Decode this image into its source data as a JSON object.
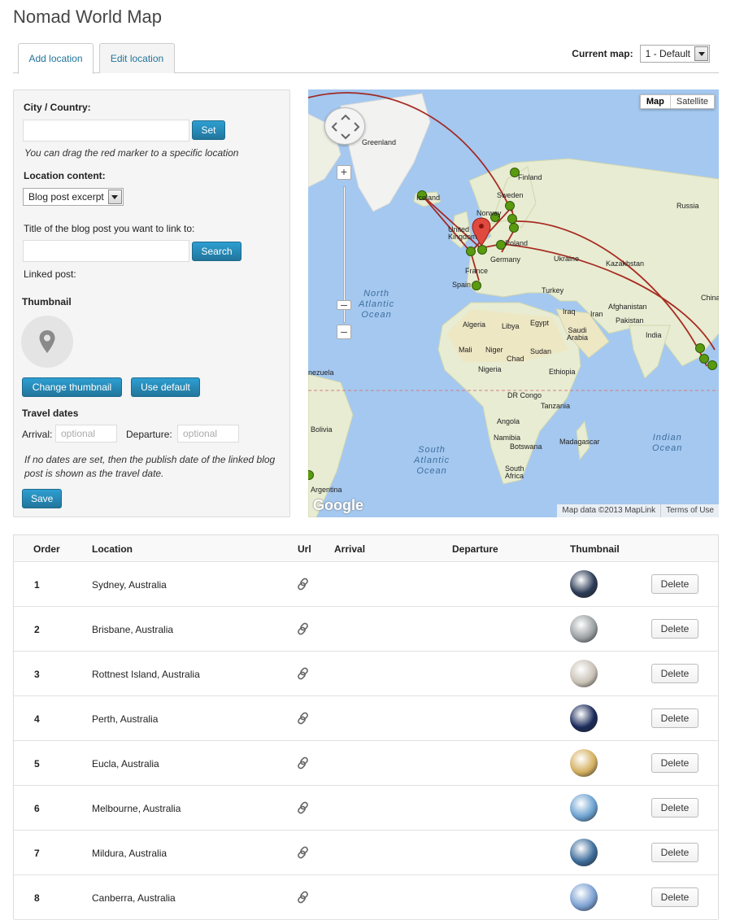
{
  "page": {
    "title": "Nomad World Map"
  },
  "tabs": [
    {
      "label": "Add location",
      "active": true
    },
    {
      "label": "Edit location",
      "active": false
    }
  ],
  "current_map": {
    "label": "Current map:",
    "selected": "1 - Default"
  },
  "form": {
    "city_label": "City / Country:",
    "city_value": "",
    "set_button": "Set",
    "drag_hint": "You can drag the red marker to a specific location",
    "content_label": "Location content:",
    "content_selected": "Blog post excerpt",
    "blog_title_label": "Title of the blog post you want to link to:",
    "blog_title_value": "",
    "search_button": "Search",
    "linked_post_label": "Linked post:",
    "thumbnail_heading": "Thumbnail",
    "change_thumbnail_button": "Change thumbnail",
    "use_default_button": "Use default",
    "travel_dates_heading": "Travel dates",
    "arrival_label": "Arrival:",
    "arrival_placeholder": "optional",
    "departure_label": "Departure:",
    "departure_placeholder": "optional",
    "dates_hint": "If no dates are set, then the publish date of the linked blog post is shown as the travel date.",
    "save_button": "Save"
  },
  "map": {
    "type_buttons": [
      "Map",
      "Satellite"
    ],
    "active_type": "Map",
    "attribution": "Map data ©2013 MapLink",
    "terms": "Terms of Use",
    "logo": "Google",
    "labels": {
      "greenland": "Greenland",
      "finland": "Finland",
      "sweden": "Sweden",
      "norway": "Norway",
      "iceland": "Iceland",
      "russia": "Russia",
      "united_kingdom": "United Kingdom",
      "poland": "Poland",
      "germany": "Germany",
      "france": "France",
      "ukraine": "Ukraine",
      "kazakhstan": "Kazakhstan",
      "spain": "Spain",
      "turkey": "Turkey",
      "china": "China",
      "afghanistan": "Afghanistan",
      "iraq": "Iraq",
      "iran": "Iran",
      "pakistan": "Pakistan",
      "algeria": "Algeria",
      "libya": "Libya",
      "egypt": "Egypt",
      "saudi_arabia": "Saudi Arabia",
      "india": "India",
      "mali": "Mali",
      "niger": "Niger",
      "chad": "Chad",
      "sudan": "Sudan",
      "nigeria": "Nigeria",
      "ethiopia": "Ethiopia",
      "venezuela": "nezuela",
      "dr_congo": "DR Congo",
      "tanzania": "Tanzania",
      "angola": "Angola",
      "namibia": "Namibia",
      "botswana": "Botswana",
      "madagascar": "Madagascar",
      "south_africa": "South Africa",
      "bolivia": "Bolivia",
      "argentina": "Argentina",
      "north_atlantic": "North\nAtlantic\nOcean",
      "south_atlantic": "South\nAtlantic\nOcean",
      "indian_ocean": "Indian\nOcean"
    }
  },
  "table": {
    "headers": {
      "order": "Order",
      "location": "Location",
      "url": "Url",
      "arrival": "Arrival",
      "departure": "Departure",
      "thumbnail": "Thumbnail"
    },
    "delete_label": "Delete",
    "rows": [
      {
        "order": "1",
        "location": "Sydney, Australia",
        "thumb_color": "#2b3a55"
      },
      {
        "order": "2",
        "location": "Brisbane, Australia",
        "thumb_color": "#9aa0a3"
      },
      {
        "order": "3",
        "location": "Rottnest Island, Australia",
        "thumb_color": "#c9c2b6"
      },
      {
        "order": "4",
        "location": "Perth, Australia",
        "thumb_color": "#1a2a5a"
      },
      {
        "order": "5",
        "location": "Eucla, Australia",
        "thumb_color": "#d4b060"
      },
      {
        "order": "6",
        "location": "Melbourne, Australia",
        "thumb_color": "#6aa0cf"
      },
      {
        "order": "7",
        "location": "Mildura, Australia",
        "thumb_color": "#3d6c9a"
      },
      {
        "order": "8",
        "location": "Canberra, Australia",
        "thumb_color": "#7b9fd1"
      }
    ]
  }
}
